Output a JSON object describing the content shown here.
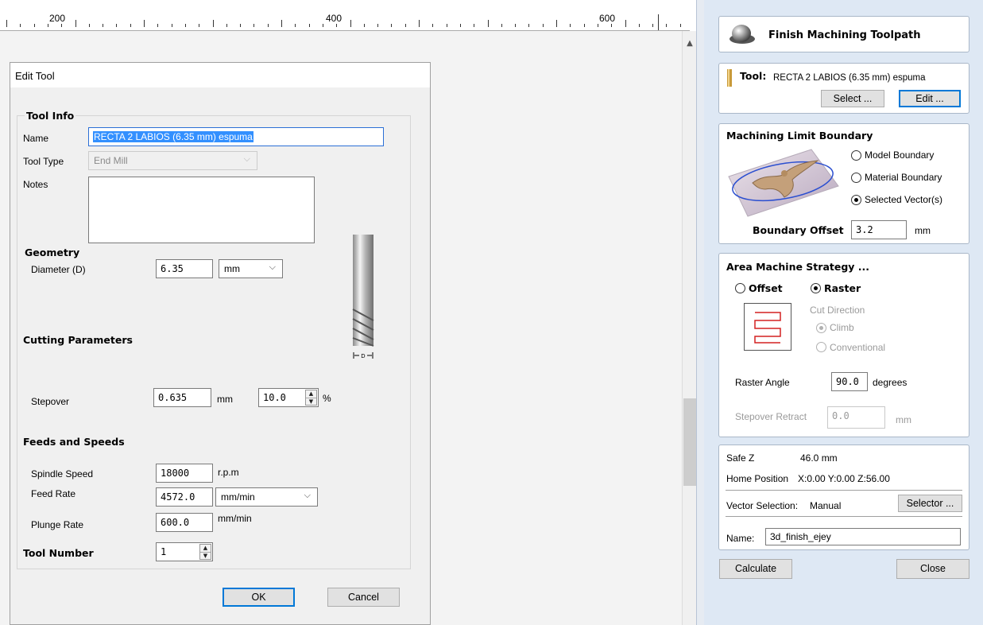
{
  "ruler": {
    "labels": [
      "200",
      "400",
      "600"
    ]
  },
  "dialog": {
    "title": "Edit Tool",
    "tool_info": {
      "heading": "Tool Info",
      "name_label": "Name",
      "name_value": "RECTA 2 LABIOS (6.35 mm) espuma",
      "tool_type_label": "Tool Type",
      "tool_type_value": "End Mill",
      "notes_label": "Notes",
      "notes_value": ""
    },
    "geometry": {
      "heading": "Geometry",
      "diameter_label": "Diameter (D)",
      "diameter_value": "6.35",
      "units_value": "mm",
      "diagram_label": "D"
    },
    "cutting": {
      "heading": "Cutting Parameters",
      "stepover_label": "Stepover",
      "stepover_value": "0.635",
      "stepover_unit": "mm",
      "stepover_percent": "10.0",
      "percent_sign": "%"
    },
    "feeds": {
      "heading": "Feeds and Speeds",
      "spindle_label": "Spindle Speed",
      "spindle_value": "18000",
      "spindle_unit": "r.p.m",
      "feed_label": "Feed Rate",
      "feed_value": "4572.0",
      "feed_unit": "mm/min",
      "plunge_label": "Plunge Rate",
      "plunge_value": "600.0",
      "plunge_unit": "mm/min"
    },
    "tool_number": {
      "label": "Tool Number",
      "value": "1"
    },
    "ok_label": "OK",
    "cancel_label": "Cancel"
  },
  "panel": {
    "header_title": "Finish Machining Toolpath",
    "tool": {
      "label": "Tool:",
      "value": "RECTA 2 LABIOS (6.35 mm) espuma",
      "select_label": "Select ...",
      "edit_label": "Edit ..."
    },
    "boundary": {
      "heading": "Machining Limit Boundary",
      "options": [
        "Model Boundary",
        "Material Boundary",
        "Selected Vector(s)"
      ],
      "selected": "Selected Vector(s)",
      "offset_label": "Boundary Offset",
      "offset_value": "3.2",
      "offset_unit": "mm"
    },
    "strategy": {
      "heading": "Area Machine Strategy ...",
      "offset_label": "Offset",
      "raster_label": "Raster",
      "selected": "Raster",
      "cut_direction_label": "Cut Direction",
      "climb_label": "Climb",
      "conventional_label": "Conventional",
      "raster_angle_label": "Raster Angle",
      "raster_angle_value": "90.0",
      "raster_angle_unit": "degrees",
      "stepover_retract_label": "Stepover Retract",
      "stepover_retract_value": "0.0",
      "stepover_retract_unit": "mm"
    },
    "info": {
      "safe_z_label": "Safe Z",
      "safe_z_value": "46.0 mm",
      "home_label": "Home Position",
      "home_value": "X:0.00 Y:0.00 Z:56.00",
      "vector_selection_label": "Vector Selection:",
      "vector_selection_value": "Manual",
      "selector_label": "Selector ...",
      "name_label": "Name:",
      "name_value": "3d_finish_ejey"
    },
    "calculate_label": "Calculate",
    "close_label": "Close"
  },
  "colors": {
    "accent": "#0078d7",
    "selection": "#3390ff",
    "panel_bg": "#dee8f4",
    "raster_red": "#d42020"
  }
}
